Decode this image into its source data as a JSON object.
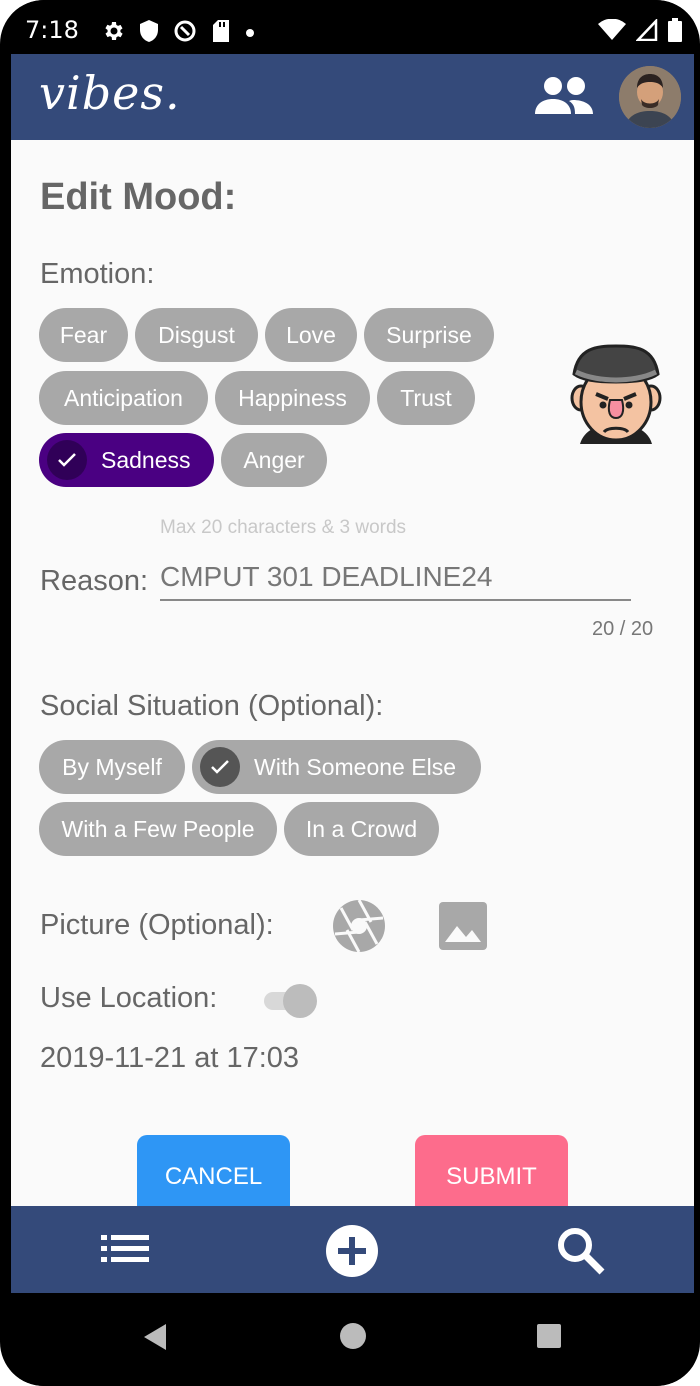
{
  "status_bar": {
    "time": "7:18"
  },
  "app_bar": {
    "logo": "vibes."
  },
  "page": {
    "title": "Edit Mood:",
    "emotion_label": "Emotion:",
    "emotions": {
      "fear": "Fear",
      "disgust": "Disgust",
      "love": "Love",
      "surprise": "Surprise",
      "anticipation": "Anticipation",
      "happiness": "Happiness",
      "trust": "Trust",
      "sadness": "Sadness",
      "anger": "Anger"
    },
    "selected_emotion": "Sadness",
    "reason_hint": "Max 20 characters & 3 words",
    "reason_label": "Reason:",
    "reason_value": "CMPUT 301 DEADLINE24",
    "reason_counter": "20 / 20",
    "social_label": "Social Situation (Optional):",
    "social": {
      "by_myself": "By Myself",
      "with_someone_else": "With Someone Else",
      "with_few_people": "With a Few People",
      "in_a_crowd": "In a Crowd"
    },
    "selected_social": "With Someone Else",
    "picture_label": "Picture (Optional):",
    "location_label": "Use Location:",
    "location_enabled": false,
    "datetime": "2019-11-21 at 17:03",
    "cancel_label": "CANCEL",
    "submit_label": "SUBMIT"
  },
  "colors": {
    "app_bar": "#344a7a",
    "chip": "#a8a8a8",
    "chip_selected": "#4a0082",
    "cancel": "#2e96f5",
    "submit": "#fd6c8c"
  }
}
